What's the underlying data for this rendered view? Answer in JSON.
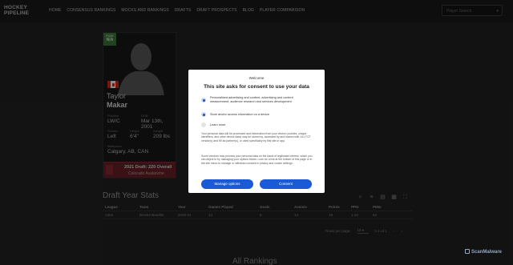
{
  "nav": {
    "logo": "HOCKEY PIPELINE",
    "links": [
      "HOME",
      "CONSENSUS RANKINGS",
      "MOCKS AND RANKINGS",
      "DRAFTS",
      "DRAFT PROSPECTS",
      "BLOG",
      "PLAYER COMPARISON"
    ],
    "search_placeholder": "Player Search"
  },
  "player": {
    "rank_label": "RANK",
    "rank_value": "N/A",
    "first_name": "Taylor",
    "last_name": "Makar",
    "position_label": "Position",
    "position": "LW/C",
    "dob_label": "DOB",
    "dob": "Mar 13th, 2001",
    "shoots_label": "Shoots",
    "shoots": "Left",
    "height_label": "Height",
    "height": "6'4\"",
    "weight_label": "Weight",
    "weight": "209 lbs",
    "birthplace_label": "Birthplace",
    "birthplace": "Calgary, AB, CAN",
    "draft_line": "2021 Draft: 220 Overall",
    "draft_team": "Colorado Avalanche",
    "colors": {
      "draft_bg": "#6a1f27",
      "rank_bg": "#3e7a3a",
      "flag": "#d52b1e"
    }
  },
  "stats": {
    "title": "Draft Year Stats",
    "columns": [
      "League",
      "Team",
      "Year",
      "Games Played",
      "Goals",
      "Assists",
      "Points",
      "PPG",
      "PIMs"
    ],
    "rows": [
      [
        "AJHL",
        "Brooks Bandits",
        "2020-21",
        "14",
        "5",
        "14",
        "19",
        "1.19",
        "62"
      ]
    ],
    "rows_per_page_label": "Rows per page:",
    "rows_per_page": "10",
    "page_range": "1-1 of 1"
  },
  "all_rankings_title": "All Rankings",
  "consent": {
    "welcome": "Welcome",
    "title": "This site asks for consent to use your data",
    "purpose1": "Personalised advertising and content, advertising and content measurement, audience research and services development",
    "purpose2": "Store and/or access information on a device",
    "learn_more": "Learn more",
    "para1": "Your personal data will be processed and information from your device (cookies, unique identifiers, and other device data) may be stored by, accessed by and shared with 141 TCF vendor(s) and 69 ad partner(s), or used specifically by this site or app.",
    "para2": "Some vendors may process your personal data on the basis of legitimate interest, which you can object to by managing your options below. Look for a link at the bottom of this page or in the site menu to manage or withdraw consent in privacy and cookie settings.",
    "manage_label": "Manage options",
    "consent_label": "Consent",
    "accent": "#1a5ad6"
  },
  "watermark": "ScanMalware"
}
